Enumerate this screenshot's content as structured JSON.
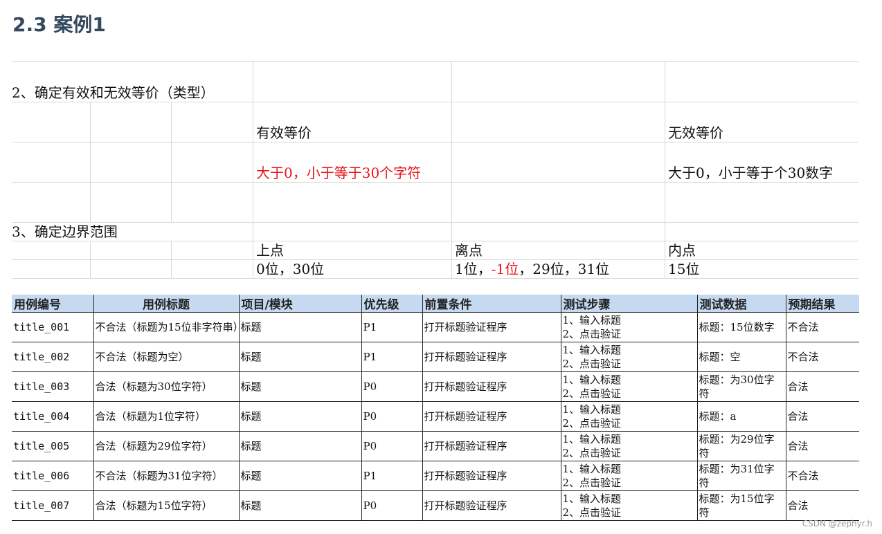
{
  "heading": "2.3 案例1",
  "sheet": {
    "step2_label": "2、确定有效和无效等价（类型）",
    "valid_label": "有效等价",
    "invalid_label": "无效等价",
    "valid_value": "大于0，小于等于30个字符",
    "invalid_value": "大于0，小于等于个30数字",
    "step3_label": "3、确定边界范围",
    "upper_label": "上点",
    "off_label": "离点",
    "inner_label": "内点",
    "upper_value": "0位，30位",
    "off_value_a": "1位，",
    "off_value_red": "-1位",
    "off_value_b": "，29位，31位",
    "inner_value": "15位"
  },
  "cases": {
    "headers": [
      "用例编号",
      "用例标题",
      "项目/模块",
      "优先级",
      "前置条件",
      "测试步骤",
      "测试数据",
      "预期结果"
    ],
    "rows": [
      {
        "id": "title_001",
        "title": "不合法（标题为15位非字符串）",
        "module": "标题",
        "priority": "P1",
        "precondition": "打开标题验证程序",
        "step1": "1、输入标题",
        "step2": "2、点击验证",
        "data": "标题：15位数字",
        "expected": "不合法"
      },
      {
        "id": "title_002",
        "title": "不合法（标题为空）",
        "module": "标题",
        "priority": "P1",
        "precondition": "打开标题验证程序",
        "step1": "1、输入标题",
        "step2": "2、点击验证",
        "data": "标题：空",
        "expected": "不合法"
      },
      {
        "id": "title_003",
        "title": "合法（标题为30位字符）",
        "module": "标题",
        "priority": "P0",
        "precondition": "打开标题验证程序",
        "step1": "1、输入标题",
        "step2": "2、点击验证",
        "data": "标题：为30位字符",
        "expected": "合法"
      },
      {
        "id": "title_004",
        "title": "合法（标题为1位字符）",
        "module": "标题",
        "priority": "P0",
        "precondition": "打开标题验证程序",
        "step1": "1、输入标题",
        "step2": "2、点击验证",
        "data": "标题：a",
        "expected": "合法"
      },
      {
        "id": "title_005",
        "title": "合法（标题为29位字符）",
        "module": "标题",
        "priority": "P0",
        "precondition": "打开标题验证程序",
        "step1": "1、输入标题",
        "step2": "2、点击验证",
        "data": "标题：为29位字符",
        "expected": "合法"
      },
      {
        "id": "title_006",
        "title": "不合法（标题为31位字符）",
        "module": "标题",
        "priority": "P1",
        "precondition": "打开标题验证程序",
        "step1": "1、输入标题",
        "step2": "2、点击验证",
        "data": "标题：为31位字符",
        "expected": "不合法"
      },
      {
        "id": "title_007",
        "title": "合法（标题为15位字符）",
        "module": "标题",
        "priority": "P0",
        "precondition": "打开标题验证程序",
        "step1": "1、输入标题",
        "step2": "2、点击验证",
        "data": "标题：为15位字符",
        "expected": "合法"
      }
    ]
  },
  "watermark": "CSDN @zephyr.h",
  "colors": {
    "header_bg": "#c5d9f1",
    "accent_red": "#e8141b",
    "heading": "#34495e"
  }
}
